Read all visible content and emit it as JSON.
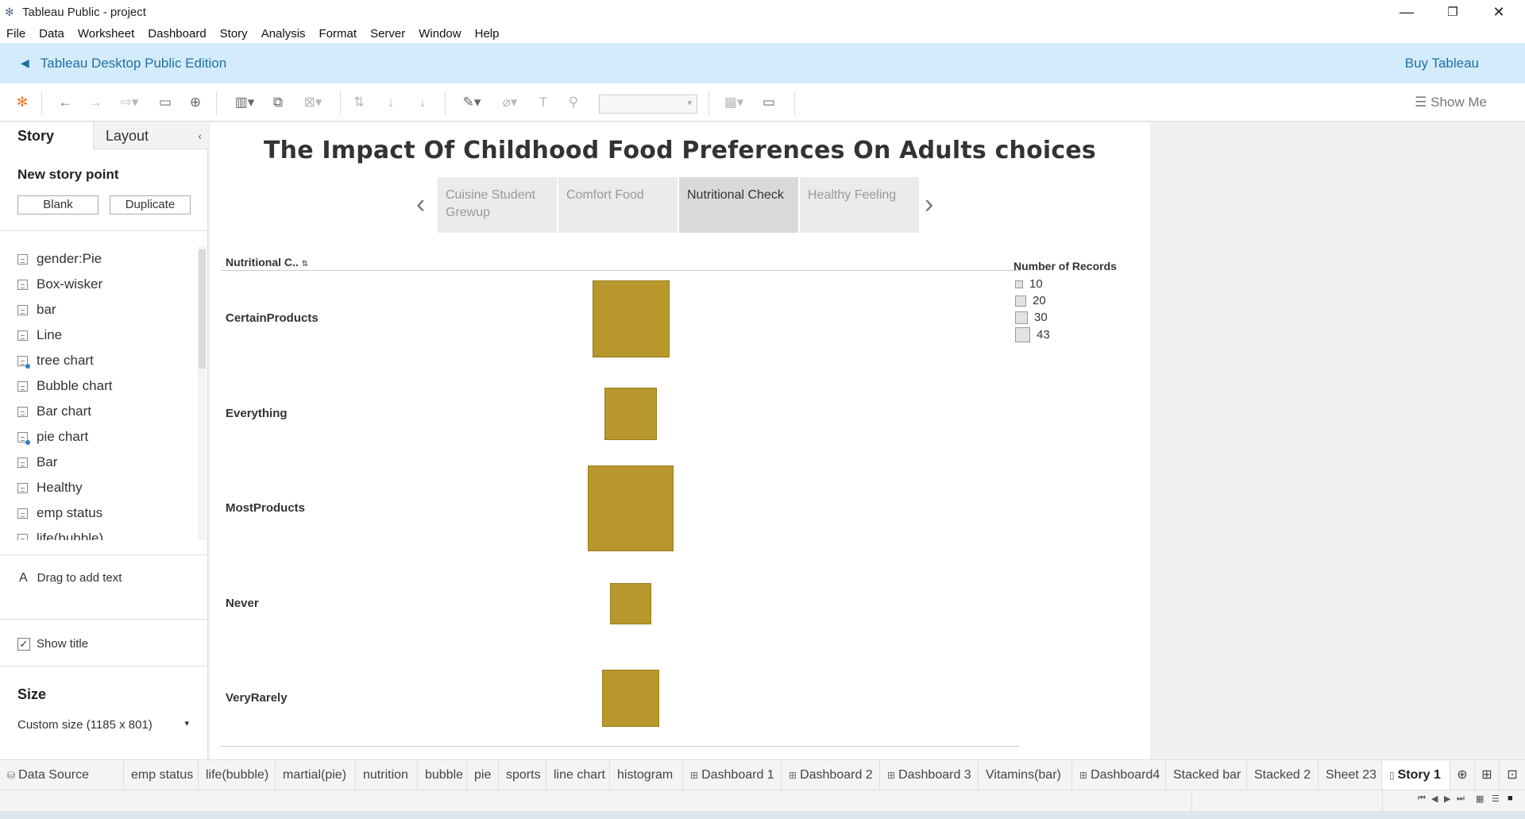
{
  "window": {
    "title": "Tableau Public - project",
    "min": "—",
    "max": "❐",
    "close": "✕"
  },
  "menu": [
    "File",
    "Data",
    "Worksheet",
    "Dashboard",
    "Story",
    "Analysis",
    "Format",
    "Server",
    "Window",
    "Help"
  ],
  "banner": {
    "edition": "Tableau Desktop Public Edition",
    "buy": "Buy Tableau"
  },
  "toolbar": {
    "show_me": "Show Me"
  },
  "sidebar": {
    "tab_story": "Story",
    "tab_layout": "Layout",
    "new_story_point": "New story point",
    "blank": "Blank",
    "duplicate": "Duplicate",
    "sheets": [
      {
        "label": "gender:Pie",
        "icon": "sheet-icon"
      },
      {
        "label": "Box-wisker",
        "icon": "sheet-icon"
      },
      {
        "label": "bar",
        "icon": "sheet-icon"
      },
      {
        "label": "Line",
        "icon": "sheet-icon"
      },
      {
        "label": "tree chart",
        "icon": "sheet-blue-icon"
      },
      {
        "label": "Bubble chart",
        "icon": "sheet-icon"
      },
      {
        "label": "Bar chart",
        "icon": "sheet-icon"
      },
      {
        "label": "pie chart",
        "icon": "sheet-blue-icon"
      },
      {
        "label": "Bar",
        "icon": "sheet-icon"
      },
      {
        "label": "Healthy",
        "icon": "sheet-icon"
      },
      {
        "label": "emp status",
        "icon": "sheet-icon"
      },
      {
        "label": "life(bubble)",
        "icon": "sheet-icon"
      }
    ],
    "drag_text": "Drag to add text",
    "show_title": "Show title",
    "size_label": "Size",
    "size_value": "Custom size (1185 x 801)"
  },
  "story": {
    "title": "The Impact Of Childhood Food Preferences On Adults choices",
    "points": [
      "Cuisine Student Grewup",
      "Comfort Food",
      "Nutritional Check",
      "Healthy Feeling"
    ],
    "active_point": 2
  },
  "chart_data": {
    "type": "square-size",
    "field": "Nutritional C..",
    "categories": [
      "CertainProducts",
      "Everything",
      "MostProducts",
      "Never",
      "VeryRarely"
    ],
    "values": [
      35,
      16,
      43,
      10,
      19
    ],
    "color": "#b8972d",
    "legend": {
      "title": "Number of Records",
      "entries": [
        "10",
        "20",
        "30",
        "43"
      ],
      "placement": "top-right"
    }
  },
  "bottom_tabs": [
    "Data Source",
    "emp status",
    "life(bubble)",
    "martial(pie)",
    "nutrition",
    "bubble",
    "pie",
    "sports",
    "line chart",
    "histogram",
    "Dashboard 1",
    "Dashboard 2",
    "Dashboard 3",
    "Vitamins(bar)",
    "Dashboard4",
    "Stacked bar",
    "Stacked 2",
    "Sheet 23",
    "Story 1"
  ]
}
